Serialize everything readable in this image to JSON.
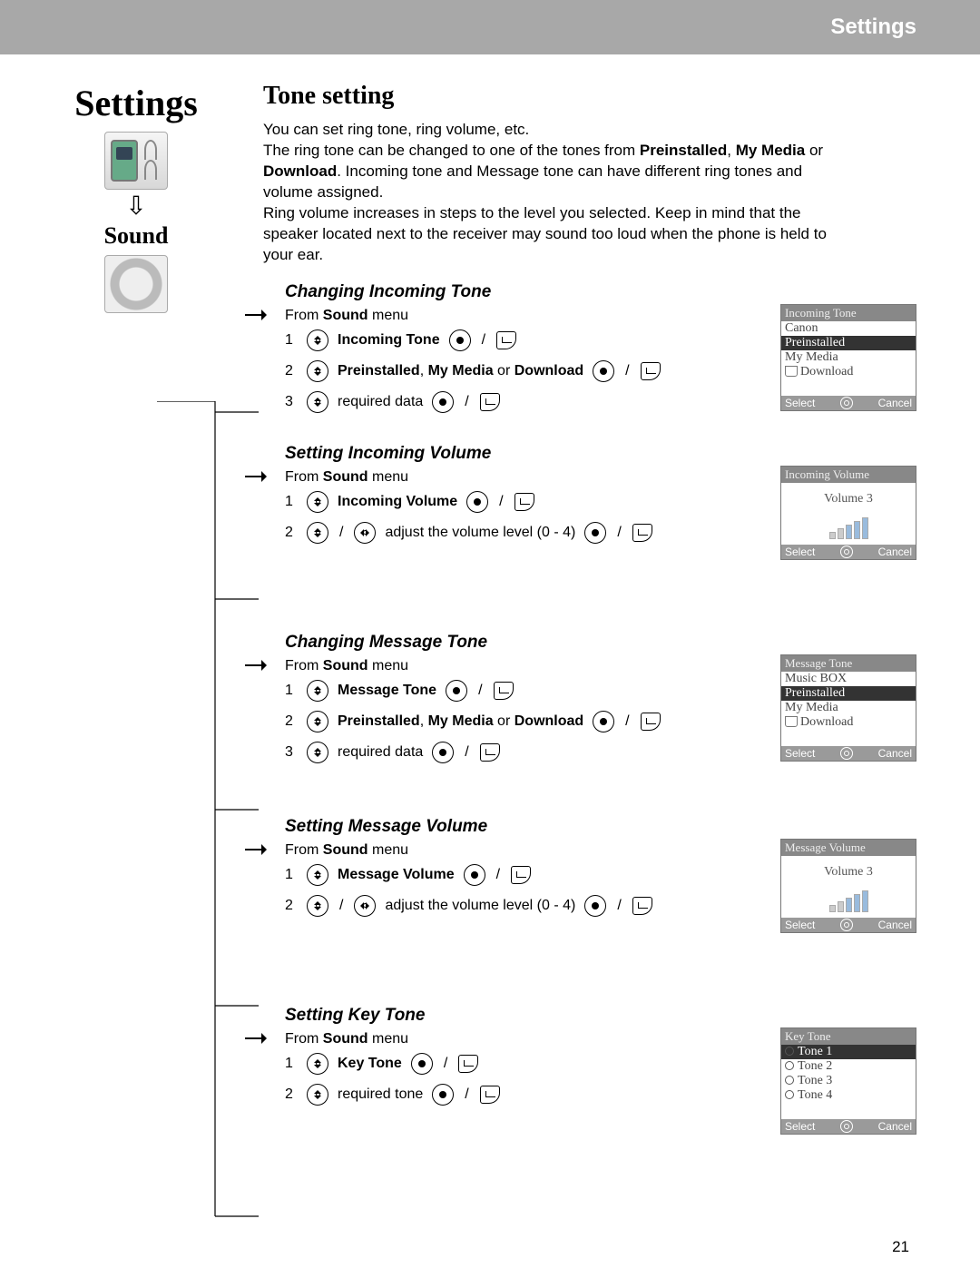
{
  "header": {
    "title": "Settings"
  },
  "left": {
    "settings": "Settings",
    "sound": "Sound"
  },
  "main": {
    "title": "Tone setting",
    "intro_parts": {
      "p1": "You can set ring tone, ring volume, etc.",
      "p2a": "The ring tone can be changed to one of the tones from ",
      "b1": "Preinstalled",
      "sep1": ", ",
      "b2": "My Media",
      "sep2": " or ",
      "b3": "Download",
      "p2b": ". Incoming tone and Message tone can have different ring tones and volume assigned.",
      "p3": "Ring volume increases in steps to the level you selected. Keep in mind that the speaker located next to the receiver may sound too loud when the phone is held to your ear."
    },
    "from_sound_a": "From ",
    "from_sound_b": "Sound",
    "from_sound_c": " menu",
    "subs": {
      "s1": {
        "title": "Changing Incoming Tone",
        "step1": "Incoming Tone",
        "step2a": "Preinstalled",
        "step2b": "My Media",
        "step2c": "Download",
        "step3": "required data"
      },
      "s2": {
        "title": "Setting Incoming Volume",
        "step1": "Incoming Volume",
        "step2": "adjust the volume level (0 - 4)"
      },
      "s3": {
        "title": "Changing Message Tone",
        "step1": "Message Tone",
        "step2a": "Preinstalled",
        "step2b": "My Media",
        "step2c": "Download",
        "step3": "required data"
      },
      "s4": {
        "title": "Setting Message Volume",
        "step1": "Message Volume",
        "step2": "adjust the volume level (0 - 4)"
      },
      "s5": {
        "title": "Setting Key Tone",
        "step1": "Key Tone",
        "step2": "required tone"
      }
    }
  },
  "mocks": {
    "m1": {
      "title": "Incoming Tone",
      "r1": "Canon",
      "r2": "Preinstalled",
      "r3": "My Media",
      "r4": "Download"
    },
    "m2": {
      "title": "Incoming Volume",
      "vol": "Volume 3"
    },
    "m3": {
      "title": "Message Tone",
      "r1": "Music BOX",
      "r2": "Preinstalled",
      "r3": "My Media",
      "r4": "Download"
    },
    "m4": {
      "title": "Message Volume",
      "vol": "Volume 3"
    },
    "m5": {
      "title": "Key Tone",
      "t1": "Tone 1",
      "t2": "Tone 2",
      "t3": "Tone 3",
      "t4": "Tone 4"
    },
    "soft": {
      "left": "Select",
      "right": "Cancel"
    }
  },
  "misc": {
    "sep_comma": ", ",
    "sep_or": " or ",
    "slash": "/",
    "n1": "1",
    "n2": "2",
    "n3": "3"
  },
  "page_number": "21"
}
